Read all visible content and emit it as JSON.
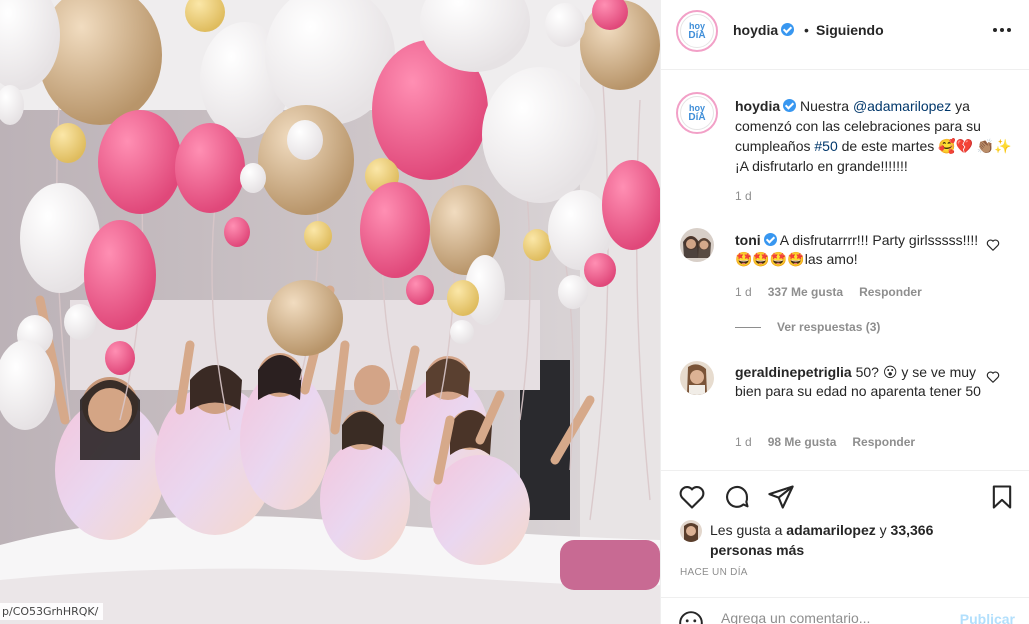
{
  "post": {
    "username": "hoydia",
    "follow_status": "Siguiendo",
    "separator": "•",
    "avatar_text_top": "hoy",
    "avatar_text_bottom": "DíA"
  },
  "caption": {
    "username": "hoydia",
    "text_before_mention": "Nuestra",
    "mention": "@adamarilopez",
    "text_mid": "ya comenzó con las celebraciones para su cumpleaños",
    "hashtag": "#50",
    "text_after": "de este martes 🥰💔 👏🏽✨ ¡A disfrutarlo en grande!!!!!!!",
    "time": "1 d"
  },
  "comments": [
    {
      "username": "toni",
      "text": "A disfrutarrrr!!! Party girlsssss!!!!🤩🤩🤩🤩las amo!",
      "time": "1 d",
      "likes": "337 Me gusta",
      "reply_label": "Responder",
      "view_replies": "Ver respuestas (3)"
    },
    {
      "username": "geraldinepetriglia",
      "text": "50? 😮 y se ve muy bien para su edad no aparenta tener 50",
      "time": "1 d",
      "likes": "98 Me gusta",
      "reply_label": "Responder"
    }
  ],
  "likes": {
    "prefix": "Les gusta a",
    "user": "adamarilopez",
    "conj": "y",
    "others": "33,366 personas más"
  },
  "timestamp": "HACE UN DÍA",
  "comment_box": {
    "placeholder": "Agrega un comentario...",
    "publish_label": "Publicar"
  },
  "photo": {
    "url_overlay": "p/CO53GrhHRQK/"
  },
  "icons": {
    "more": "more-horizontal-icon",
    "like": "heart-icon",
    "comment": "comment-bubble-icon",
    "share": "paper-plane-icon",
    "save": "bookmark-icon",
    "emoji": "emoji-smile-icon",
    "verified": "verified-badge-icon"
  },
  "colors": {
    "accent_blue": "#3897f0",
    "link": "#00376b",
    "muted": "#8e8e8e",
    "publish_disabled": "#b2dffc",
    "balloon_pink": "#e8557f",
    "balloon_gold": "#c9a876"
  }
}
